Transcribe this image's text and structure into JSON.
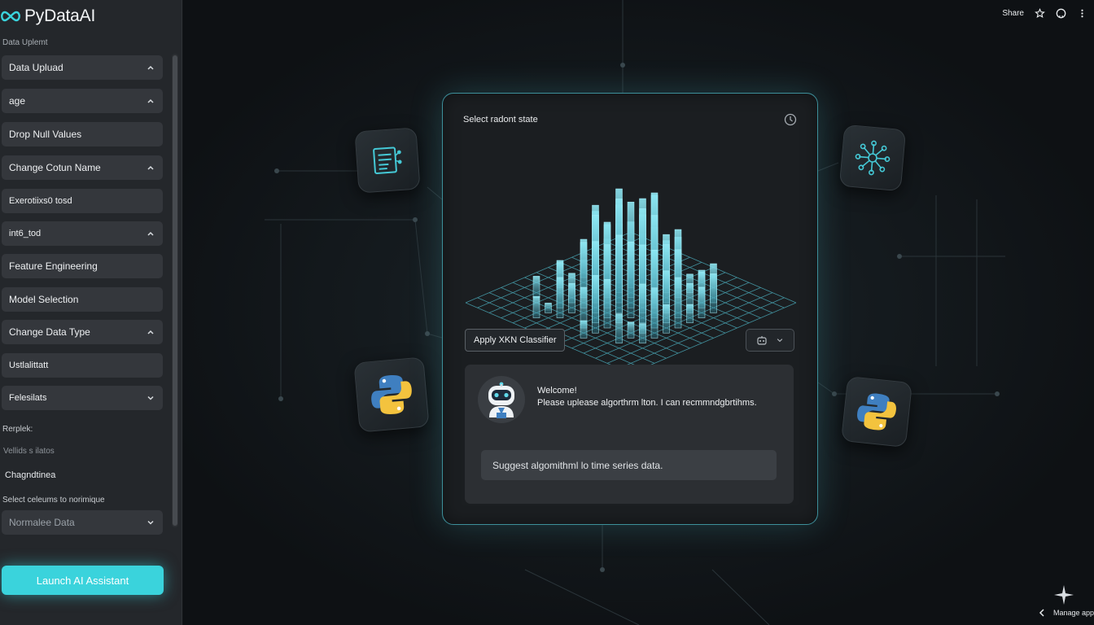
{
  "app": {
    "name": "PyDataAI"
  },
  "sidebar": {
    "caption": "Data Uplemt",
    "items": [
      {
        "label": "Data Upluad",
        "chevron": "up"
      },
      {
        "label": "age",
        "chevron": "up"
      },
      {
        "label": "Drop Null Values",
        "chevron": "none"
      },
      {
        "label": "Change Cotun Name",
        "chevron": "up"
      },
      {
        "label": "Exerotiixs0 tosd",
        "chevron": "none"
      },
      {
        "label": "int6_tod",
        "chevron": "up"
      },
      {
        "label": "Feature Engineering",
        "chevron": "none"
      },
      {
        "label": "Model Selection",
        "chevron": "none"
      },
      {
        "label": "Change Data Type",
        "chevron": "up"
      },
      {
        "label": "Ustlalittatt",
        "chevron": "none"
      },
      {
        "label": "Felesilats",
        "chevron": "down"
      }
    ],
    "labels": {
      "replek": "Rerplek:",
      "vellids": "Vellids s ilatos",
      "chagndtinea": "Chagndtinea",
      "select_columns": "Select celeums to norimique"
    },
    "normalize_select": {
      "value": "Normalee Data",
      "icon": "chevron-down-icon"
    },
    "launch_button": "Launch AI Assistant"
  },
  "topbar": {
    "share_label": "Share",
    "icons": [
      "star-icon",
      "github-icon",
      "more-vertical-icon"
    ]
  },
  "footer": {
    "manage_label": "Manage app"
  },
  "card": {
    "title": "Select radont state",
    "apply_button": "Apply XKN Classifier",
    "chat": {
      "welcome": "Welcome!",
      "message": "Please uplease algorthrm lton. I can recmmndgbrtihms.",
      "suggestion": "Suggest algomithml lo time series data."
    }
  },
  "floating_icons": [
    "document-icon",
    "network-graph-icon",
    "python-logo-icon",
    "python-logo-icon"
  ],
  "colors": {
    "accent": "#3ad3dc",
    "sidebar_bg": "#24272b",
    "card_border": "#3d8f9a",
    "python_blue": "#3f7fc0",
    "python_yellow": "#f3c33e"
  }
}
